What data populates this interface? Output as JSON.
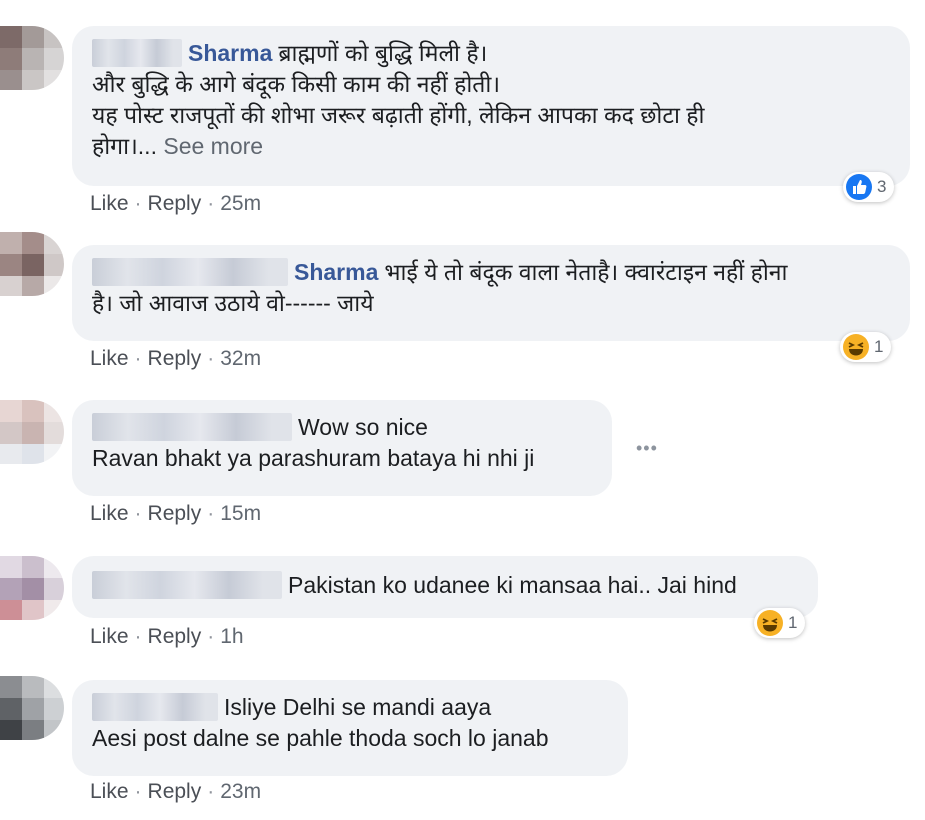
{
  "comments": [
    {
      "author": "Sharma",
      "lines": [
        "ब्राह्मणों को बुद्धि मिली है।",
        "और बुद्धि के आगे बंदूक किसी काम की नहीं होती।",
        "यह पोस्ट राजपूतों की शोभा जरूर बढ़ाती होंगी, लेकिन आपका कद छोटा ही",
        "होगा।..."
      ],
      "see_more": "See more",
      "like": "Like",
      "reply": "Reply",
      "time": "25m",
      "reaction_icon": "like-icon",
      "reaction_count": "3"
    },
    {
      "author": "Sharma",
      "lines": [
        "भाई ये तो बंदूक वाला नेताहै। क्वारंटाइन नहीं होना",
        "है। जो आवाज उठाये वो------ जाये"
      ],
      "like": "Like",
      "reply": "Reply",
      "time": "32m",
      "reaction_icon": "haha-icon",
      "reaction_count": "1"
    },
    {
      "lines": [
        "Wow so nice",
        "Ravan bhakt ya parashuram bataya hi nhi ji"
      ],
      "like": "Like",
      "reply": "Reply",
      "time": "15m",
      "more_icon": "more-options-icon"
    },
    {
      "lines": [
        "Pakistan ko udanee ki mansaa hai.. Jai hind"
      ],
      "like": "Like",
      "reply": "Reply",
      "time": "1h",
      "reaction_icon": "haha-icon",
      "reaction_count": "1"
    },
    {
      "lines": [
        "Isliye Delhi se mandi aaya",
        "Aesi post dalne se pahle thoda soch lo janab"
      ],
      "like": "Like",
      "reply": "Reply",
      "time": "23m"
    }
  ],
  "colors": {
    "bubble": "#f0f2f5",
    "author_link": "#385898",
    "meta_text": "#606770",
    "like_reaction": "#1877f2",
    "haha_reaction": "#f7b125"
  },
  "separator": "·"
}
